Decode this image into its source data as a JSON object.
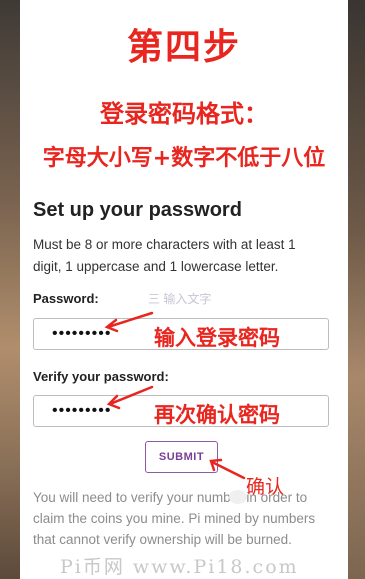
{
  "annotations": {
    "step_title": "第四步",
    "format_title": "登录密码格式：",
    "format_rule": "字母大小写+数字不低于八位",
    "enter_password": "输入登录密码",
    "reenter_password": "再次确认密码",
    "confirm": "确认"
  },
  "form": {
    "title": "Set up your password",
    "description": "Must be 8 or more characters with at least 1 digit, 1 uppercase and 1 lowercase letter.",
    "password_label": "Password:",
    "password_value": "•••••••••",
    "verify_label": "Verify your password:",
    "verify_value": "•••••••••",
    "submit_label": "SUBMIT",
    "note": "You will need to verify your number in order to claim the coins you mine. Pi mined by numbers that cannot verify ownership will be burned."
  },
  "ghost_text": "三 输入文字",
  "watermark": "Pi币网 www.Pi18.com",
  "colors": {
    "annotation_red": "#e8261f",
    "button_purple": "#7a3f95",
    "text_dark": "#222222",
    "text_muted": "#8c8c8c"
  }
}
